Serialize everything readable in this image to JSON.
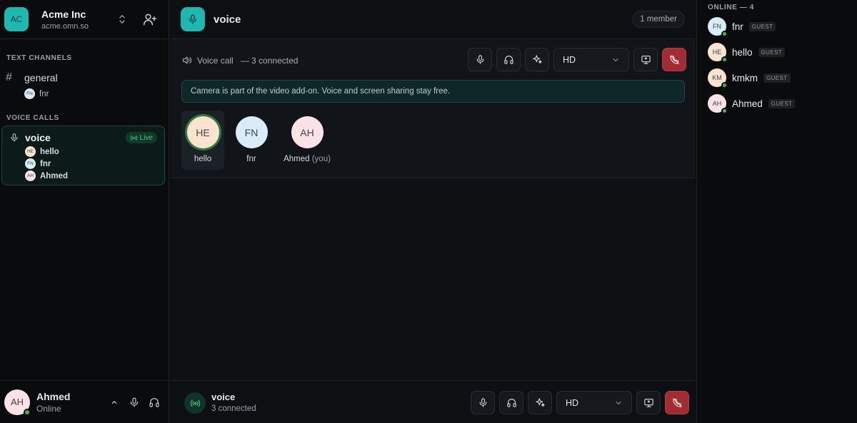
{
  "workspace": {
    "initials": "AC",
    "name": "Acme Inc",
    "domain": "acme.omn.so"
  },
  "sidebar": {
    "text_channels_title": "TEXT CHANNELS",
    "text_channels": [
      {
        "name": "general",
        "members": [
          {
            "initials": "FN",
            "name": "fnr"
          }
        ]
      }
    ],
    "voice_calls_title": "VOICE CALLS",
    "voice_calls": [
      {
        "name": "voice",
        "badge": "Live",
        "members": [
          {
            "initials": "HE",
            "name": "hello"
          },
          {
            "initials": "FN",
            "name": "fnr"
          },
          {
            "initials": "AH",
            "name": "Ahmed"
          }
        ]
      }
    ]
  },
  "current_user": {
    "initials": "AH",
    "name": "Ahmed",
    "status": "Online"
  },
  "channel": {
    "name": "voice",
    "member_count": "1 member"
  },
  "call": {
    "type_label": "Voice call",
    "connected_label": "— 3 connected",
    "quality": "HD",
    "notice": "Camera is part of the video add-on. Voice and screen sharing stay free.",
    "participants": [
      {
        "initials": "HE",
        "name": "hello",
        "suffix": "",
        "color": "#fbe3cf",
        "speaking": true
      },
      {
        "initials": "FN",
        "name": "fnr",
        "suffix": "",
        "color": "#d8ecfa",
        "speaking": false
      },
      {
        "initials": "AH",
        "name": "Ahmed",
        "suffix": "(you)",
        "color": "#fbe1e8",
        "speaking": false
      }
    ],
    "footer_title": "voice",
    "footer_sub": "3 connected"
  },
  "members_panel": {
    "title": "ONLINE — 4",
    "members": [
      {
        "initials": "FN",
        "name": "fnr",
        "role": "GUEST",
        "color": "#d8ecfa"
      },
      {
        "initials": "HE",
        "name": "hello",
        "role": "GUEST",
        "color": "#fbe3cf"
      },
      {
        "initials": "KM",
        "name": "kmkm",
        "role": "GUEST",
        "color": "#fbe3cf"
      },
      {
        "initials": "AH",
        "name": "Ahmed",
        "role": "GUEST",
        "color": "#fbe1e8"
      }
    ]
  },
  "colors": {
    "accent": "#1fb8b1",
    "live": "#3ecb78",
    "danger": "#a12d32",
    "online": "#3fb950"
  }
}
